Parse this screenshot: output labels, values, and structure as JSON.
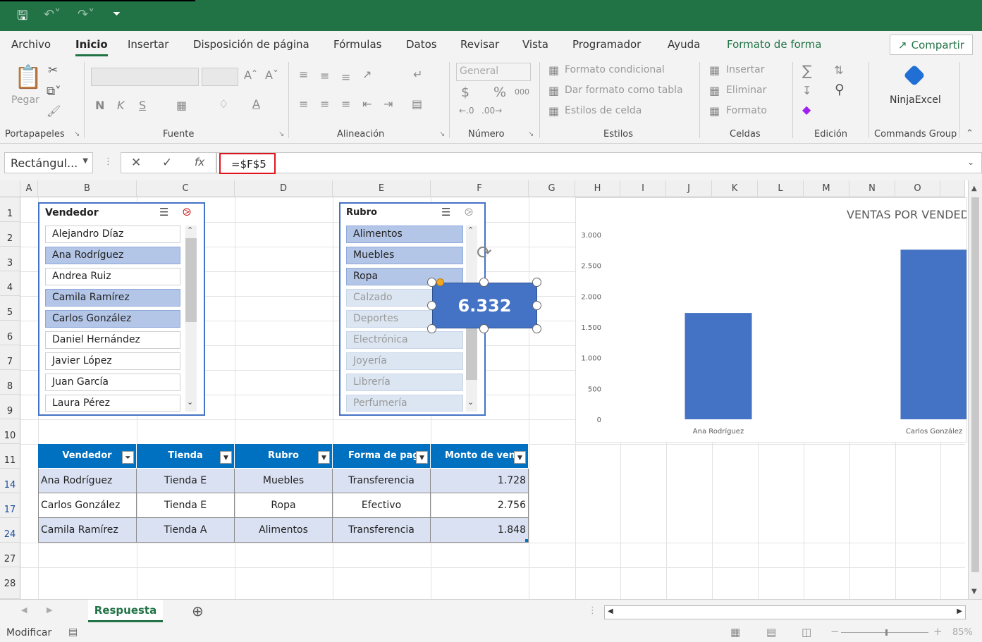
{
  "app": {
    "accent": "#217346"
  },
  "menu": {
    "items": [
      "Archivo",
      "Inicio",
      "Insertar",
      "Disposición de página",
      "Fórmulas",
      "Datos",
      "Revisar",
      "Vista",
      "Programador",
      "Ayuda",
      "Formato de forma"
    ],
    "share": "Compartir"
  },
  "ribbon": {
    "groups": [
      "Portapapeles",
      "Fuente",
      "Alineación",
      "Número",
      "Estilos",
      "Celdas",
      "Edición",
      "Commands Group"
    ],
    "paste": "Pegar",
    "bold": "N",
    "italic": "K",
    "underline": "S",
    "number_format": "General",
    "percent": "%",
    "thousands": "000",
    "currency": "$",
    "cond_format": "Formato condicional",
    "format_table": "Dar formato como tabla",
    "cell_styles": "Estilos de celda",
    "insert": "Insertar",
    "delete": "Eliminar",
    "format": "Formato",
    "ninja": "NinjaExcel"
  },
  "formula_bar": {
    "name_box": "Rectángul...",
    "formula": "=$F$5"
  },
  "columns": [
    "A",
    "B",
    "C",
    "D",
    "E",
    "F",
    "G",
    "H",
    "I",
    "J",
    "K",
    "L",
    "M",
    "N",
    "O"
  ],
  "rows": [
    "1",
    "2",
    "3",
    "4",
    "5",
    "6",
    "7",
    "8",
    "9",
    "10",
    "11",
    "14",
    "17",
    "24",
    "27",
    "28"
  ],
  "slicer_vendedor": {
    "title": "Vendedor",
    "items": [
      {
        "label": "Alejandro Díaz",
        "state": "unsel"
      },
      {
        "label": "Ana Rodríguez",
        "state": "sel"
      },
      {
        "label": "Andrea Ruiz",
        "state": "unsel"
      },
      {
        "label": "Camila Ramírez",
        "state": "sel"
      },
      {
        "label": "Carlos González",
        "state": "sel"
      },
      {
        "label": "Daniel Hernández",
        "state": "unsel"
      },
      {
        "label": "Javier López",
        "state": "unsel"
      },
      {
        "label": "Juan García",
        "state": "unsel"
      },
      {
        "label": "Laura Pérez",
        "state": "unsel"
      }
    ]
  },
  "slicer_rubro": {
    "title": "Rubro",
    "items": [
      {
        "label": "Alimentos",
        "state": "sel"
      },
      {
        "label": "Muebles",
        "state": "sel"
      },
      {
        "label": "Ropa",
        "state": "sel"
      },
      {
        "label": "Calzado",
        "state": "dim"
      },
      {
        "label": "Deportes",
        "state": "dim"
      },
      {
        "label": "Electrónica",
        "state": "dim"
      },
      {
        "label": "Joyería",
        "state": "dim"
      },
      {
        "label": "Librería",
        "state": "dim"
      },
      {
        "label": "Perfumería",
        "state": "dim"
      }
    ]
  },
  "table": {
    "headers": [
      "Vendedor",
      "Tienda",
      "Rubro",
      "Forma de pago",
      "Monto de venta"
    ],
    "rows": [
      [
        "Ana Rodríguez",
        "Tienda E",
        "Muebles",
        "Transferencia",
        "1.728"
      ],
      [
        "Carlos González",
        "Tienda E",
        "Ropa",
        "Efectivo",
        "2.756"
      ],
      [
        "Camila Ramírez",
        "Tienda A",
        "Alimentos",
        "Transferencia",
        "1.848"
      ]
    ]
  },
  "kpi_shape": {
    "value": "6.332"
  },
  "chart_data": {
    "type": "bar",
    "title": "VENTAS POR VENDED",
    "categories": [
      "Ana Rodríguez",
      "Carlos González"
    ],
    "values": [
      1728,
      2756
    ],
    "ylim": [
      0,
      3000
    ],
    "yticks": [
      "0",
      "500",
      "1.000",
      "1.500",
      "2.000",
      "2.500",
      "3.000"
    ],
    "bar_color": "#4472c4"
  },
  "sheet_tab": "Respuesta",
  "status": {
    "mode": "Modificar",
    "zoom": "85%"
  }
}
